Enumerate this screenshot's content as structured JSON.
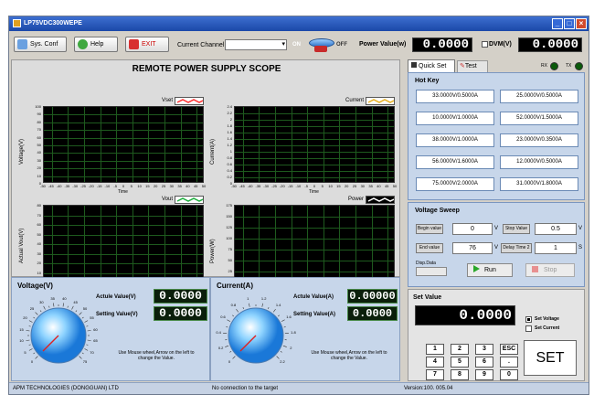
{
  "title_bar": {
    "title": "LP75VDC300WEPE"
  },
  "toolbar": {
    "sys_conf": "Sys. Conf",
    "help": "Help",
    "exit": "EXIT",
    "current_channel_label": "Current Channel",
    "current_channel_value": "",
    "on_label": "ON",
    "off_label": "OFF",
    "power_value_label": "Power Value(w)",
    "power_value": "0.0000",
    "dvm_label": "DVM(V)",
    "dvm_value": "0.0000"
  },
  "scope": {
    "title": "REMOTE POWER SUPPLY SCOPE",
    "plots": [
      {
        "legend": "Vset",
        "ylabel": "Voltage(V)",
        "xlabel": "Time",
        "yticks": [
          "100",
          "90",
          "80",
          "70",
          "60",
          "50",
          "40",
          "30",
          "20",
          "10",
          "0"
        ],
        "xticks": [
          "-50",
          "-45",
          "-40",
          "-35",
          "-30",
          "-25",
          "-20",
          "-15",
          "-10",
          "-5",
          "0",
          "5",
          "10",
          "15",
          "20",
          "25",
          "30",
          "35",
          "40",
          "45",
          "50"
        ],
        "color": "#ff3030"
      },
      {
        "legend": "Current",
        "ylabel": "Current(A)",
        "xlabel": "Time",
        "yticks": [
          "2.4",
          "2.2",
          "2",
          "1.8",
          "1.6",
          "1.4",
          "1.2",
          "1",
          "0.8",
          "0.6",
          "0.4",
          "0.2",
          "0"
        ],
        "xticks": [
          "-50",
          "-45",
          "-40",
          "-35",
          "-30",
          "-25",
          "-20",
          "-15",
          "-10",
          "-5",
          "0",
          "5",
          "10",
          "15",
          "20",
          "25",
          "30",
          "35",
          "40",
          "45",
          "50"
        ],
        "color": "#e8b020"
      },
      {
        "legend": "Vout",
        "ylabel": "Actual Vout(V)",
        "xlabel": "Time",
        "yticks": [
          "80",
          "70",
          "60",
          "50",
          "40",
          "30",
          "20",
          "10",
          "0"
        ],
        "xticks": [
          "-50",
          "-45",
          "-40",
          "-35",
          "-30",
          "-25",
          "-20",
          "-15",
          "-10",
          "-5",
          "0",
          "5",
          "10",
          "15",
          "20",
          "25",
          "30",
          "35",
          "40",
          "45",
          "50"
        ],
        "color": "#20b040"
      },
      {
        "legend": "Power",
        "ylabel": "Power(W)",
        "xlabel": "Time",
        "yticks": [
          "175",
          "150",
          "125",
          "100",
          "75",
          "50",
          "25",
          "0"
        ],
        "xticks": [
          "-50",
          "-45",
          "-40",
          "-35",
          "-30",
          "-25",
          "-20",
          "-15",
          "-10",
          "-5",
          "0",
          "5",
          "10",
          "15",
          "20",
          "25",
          "30",
          "35",
          "40",
          "45",
          "50"
        ],
        "color": "#ffffff"
      }
    ]
  },
  "voltage_panel": {
    "title": "Voltage(V)",
    "actual_label": "Actule Value(V)",
    "actual_value": "0.0000",
    "setting_label": "Setting Value(V)",
    "setting_value": "0.0000",
    "hint": "Use Mouse wheel,Arrow on the left to change the Value.",
    "dial_ticks": [
      "0",
      "5",
      "10",
      "15",
      "20",
      "25",
      "30",
      "35",
      "40",
      "45",
      "50",
      "55",
      "60",
      "65",
      "70",
      "75"
    ]
  },
  "current_panel": {
    "title": "Current(A)",
    "actual_label": "Actule Value(A)",
    "actual_value": "0.00000",
    "setting_label": "Setting Value(A)",
    "setting_value": "0.0000",
    "hint": "Use Mouse wheel,Arrow on the left to change the Value.",
    "dial_ticks": [
      "0",
      "0.2",
      "0.4",
      "0.6",
      "0.8",
      "1",
      "1.2",
      "1.4",
      "1.6",
      "1.8",
      "2",
      "2.2"
    ]
  },
  "tabs": {
    "quick_set": "Quick Set",
    "test": "Test",
    "rx": "RX",
    "tx": "TX"
  },
  "hot_key": {
    "title": "Hot Key",
    "items": [
      "33.0000V/0.5000A",
      "25.0000V/0.5000A",
      "10.0000V/1.0000A",
      "52.0000V/1.5000A",
      "38.0000V/1.0000A",
      "23.0000V/0.3500A",
      "56.0000V/1.6000A",
      "12.0000V/0.5000A",
      "75.0000V/2.0000A",
      "31.0000V/1.8000A"
    ]
  },
  "voltage_sweep": {
    "title": "Voltage Sweep",
    "begin_label": "Begin value",
    "begin_value": "0",
    "begin_unit": "V",
    "stop_label": "Stop Value",
    "stop_value": "0.5",
    "stop_unit": "V",
    "end_label": "End value",
    "end_value": "76",
    "end_unit": "V",
    "delay_label": "Delay Time 2",
    "delay_value": "1",
    "delay_unit": "S",
    "disp_label": "Disp.Data",
    "run": "Run",
    "stop": "Stop"
  },
  "set_value": {
    "title": "Set Value",
    "display": "0.0000",
    "set_voltage": "Set Voltage",
    "set_current": "Set Current",
    "keys": [
      "1",
      "2",
      "3",
      "ESC",
      "4",
      "5",
      "6",
      ".",
      "7",
      "8",
      "9",
      "0"
    ],
    "set_button": "SET"
  },
  "status_bar": {
    "company": "APM TECHNOLOGIES (DONGGUAN) LTD",
    "connection": "No connection to the target",
    "version": "Version:100. 005.04"
  }
}
